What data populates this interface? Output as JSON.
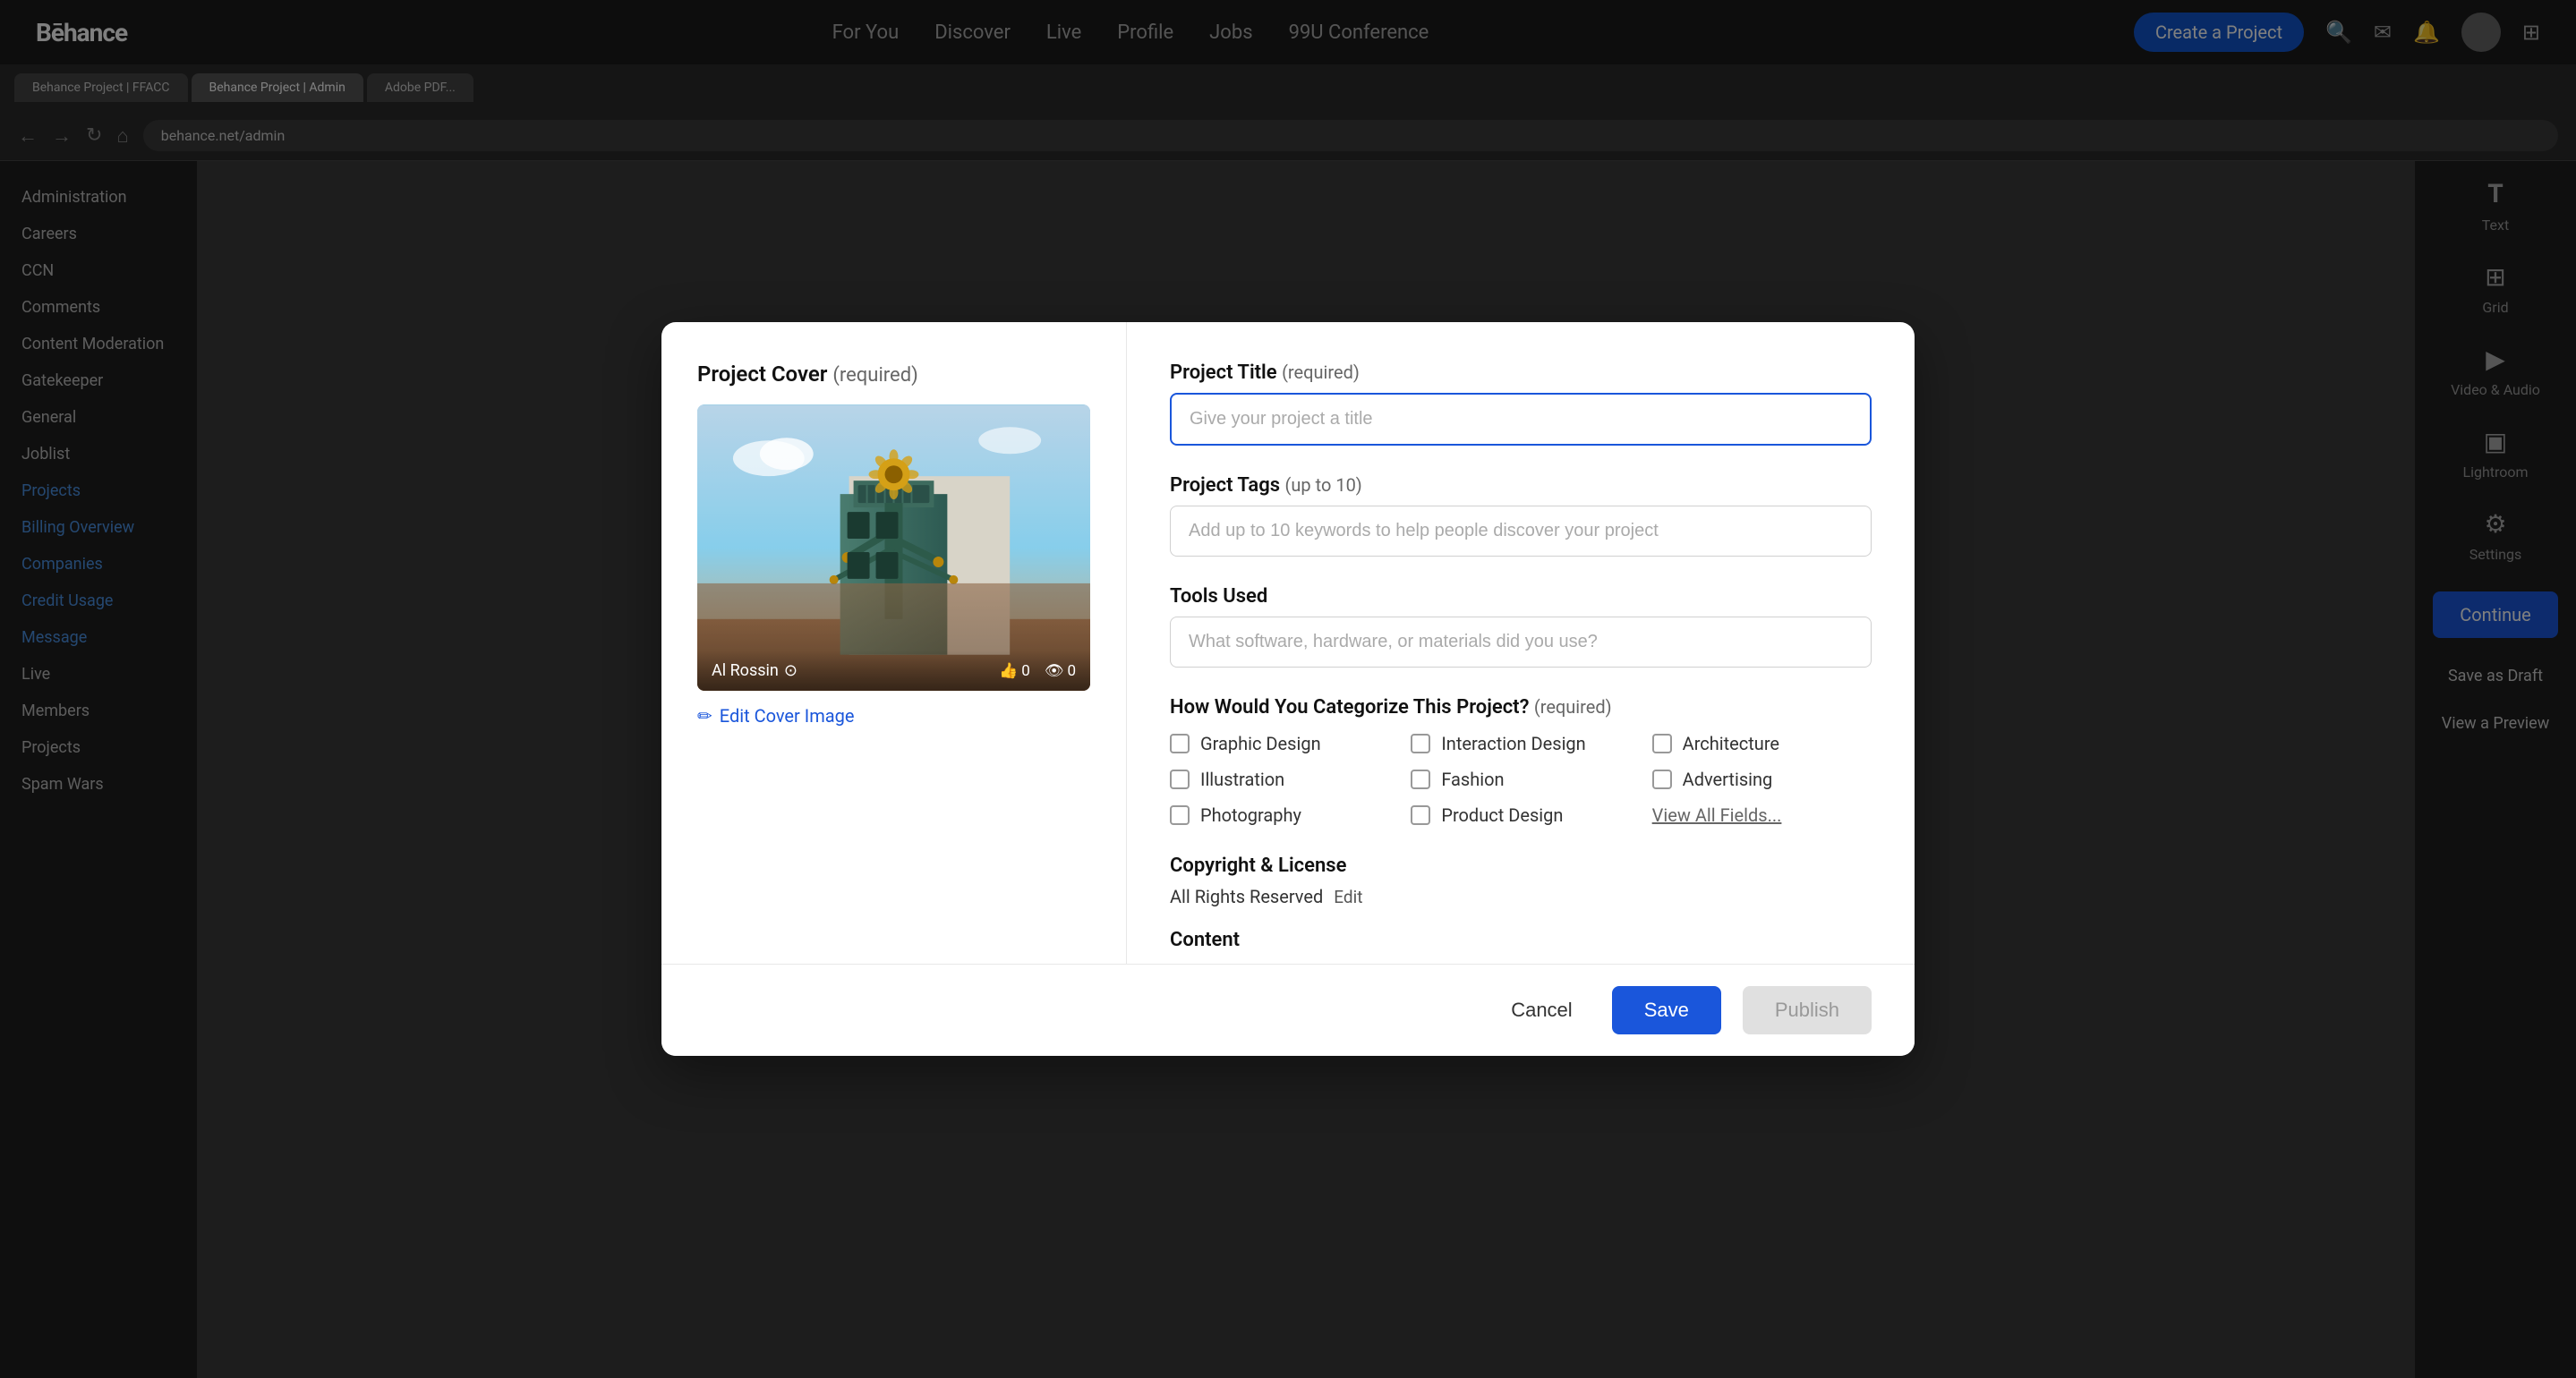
{
  "behance": {
    "logo": "Bēhance",
    "nav": {
      "links": [
        "For You",
        "Discover",
        "Live",
        "Profile",
        "Jobs",
        "99U Conference"
      ],
      "create_label": "Create a Project"
    }
  },
  "browser": {
    "tabs": [
      {
        "label": "Behance Project | FFACC",
        "active": false
      },
      {
        "label": "Behance Project | Admin",
        "active": true
      },
      {
        "label": "Adobe PDF...",
        "active": false
      }
    ]
  },
  "sidebar": {
    "items": [
      {
        "label": "Administration"
      },
      {
        "label": "Careers"
      },
      {
        "label": "CCN"
      },
      {
        "label": "Comments"
      },
      {
        "label": "Content Moderation"
      },
      {
        "label": "Gatekeeper"
      },
      {
        "label": "General"
      },
      {
        "label": "Joblist"
      },
      {
        "label": "Projects"
      },
      {
        "label": "Billing Overview"
      },
      {
        "label": "Companies"
      },
      {
        "label": "Credit Usage"
      },
      {
        "label": "Message"
      },
      {
        "label": "Live"
      },
      {
        "label": "Members"
      },
      {
        "label": "Projects"
      },
      {
        "label": "Spam Wars"
      }
    ]
  },
  "right_panel": {
    "items": [
      {
        "label": "Text",
        "icon": "T"
      },
      {
        "label": "Grid",
        "icon": "⊞"
      },
      {
        "label": "Video & Audio",
        "icon": "▶"
      },
      {
        "label": "Lightroom",
        "icon": "▣"
      },
      {
        "label": "Settings",
        "icon": "⚙"
      }
    ],
    "continue_label": "Continue",
    "save_draft_label": "Save as Draft",
    "view_preview_label": "View a Preview"
  },
  "modal": {
    "left": {
      "cover_title": "Project Cover",
      "cover_required": "(required)",
      "author_name": "Al Rossin",
      "likes_count": "0",
      "views_count": "0",
      "edit_cover_label": "Edit Cover Image"
    },
    "right": {
      "project_title_label": "Project Title",
      "project_title_required": "(required)",
      "project_title_placeholder": "Give your project a title",
      "project_tags_label": "Project Tags",
      "project_tags_sublabel": "(up to 10)",
      "project_tags_placeholder": "Add up to 10 keywords to help people discover your project",
      "tools_used_label": "Tools Used",
      "tools_used_placeholder": "What software, hardware, or materials did you use?",
      "categorize_label": "How Would You Categorize This Project?",
      "categorize_required": "(required)",
      "categories": [
        {
          "label": "Graphic Design",
          "checked": false
        },
        {
          "label": "Interaction Design",
          "checked": false
        },
        {
          "label": "Architecture",
          "checked": false
        },
        {
          "label": "Illustration",
          "checked": false
        },
        {
          "label": "Fashion",
          "checked": false
        },
        {
          "label": "Advertising",
          "checked": false
        },
        {
          "label": "Photography",
          "checked": false
        },
        {
          "label": "Product Design",
          "checked": false
        }
      ],
      "view_all_label": "View All Fields...",
      "copyright_label": "Copyright & License",
      "copyright_value": "All Rights Reserved",
      "copyright_edit": "Edit",
      "content_label": "Content"
    },
    "footer": {
      "cancel_label": "Cancel",
      "save_label": "Save",
      "publish_label": "Publish"
    }
  }
}
